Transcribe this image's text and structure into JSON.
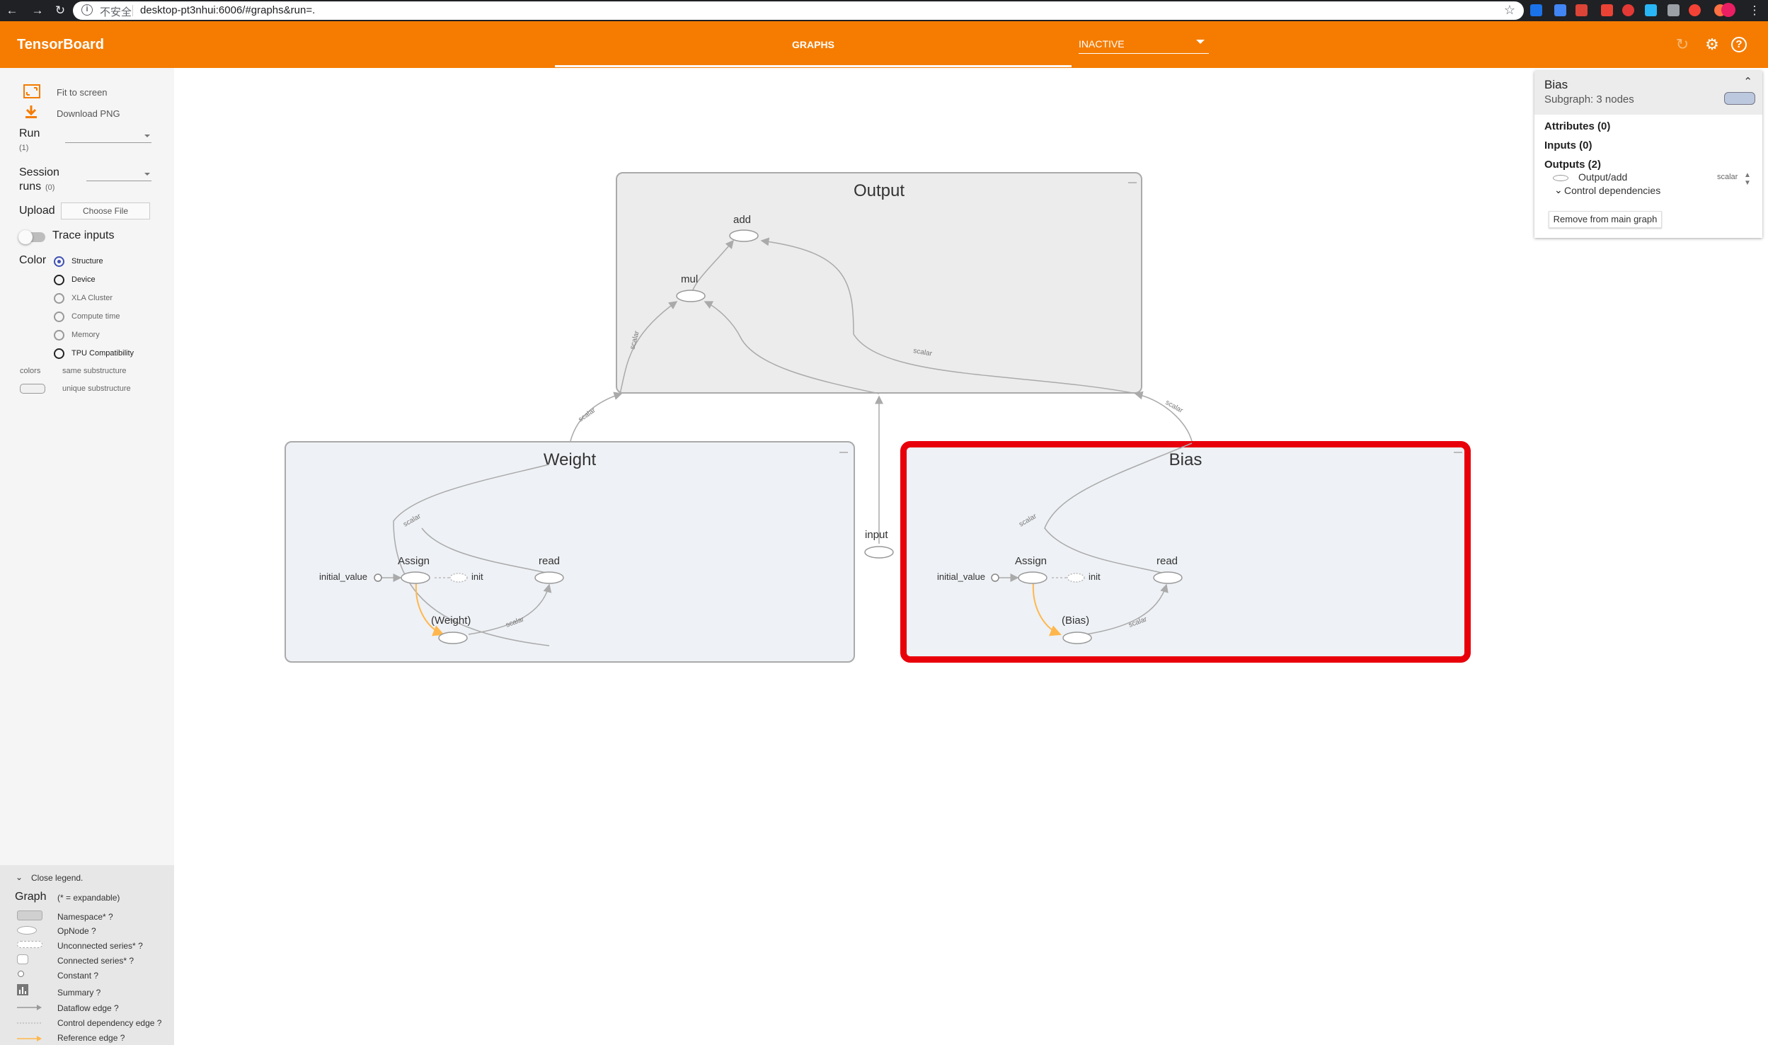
{
  "browser": {
    "insecure_label": "不安全",
    "url": "desktop-pt3nhui:6006/#graphs&run=."
  },
  "toolbar": {
    "title": "TensorBoard",
    "tab_graphs": "GRAPHS",
    "inactive_label": "INACTIVE"
  },
  "sidebar": {
    "fit_to_screen": "Fit to screen",
    "download_png": "Download PNG",
    "run_label": "Run",
    "run_count": "(1)",
    "session_label_1": "Session",
    "session_label_2": "runs",
    "session_count": "(0)",
    "upload_label": "Upload",
    "choose_file": "Choose File",
    "trace_inputs": "Trace inputs",
    "color_label": "Color",
    "color_options": [
      "Structure",
      "Device",
      "XLA Cluster",
      "Compute time",
      "Memory",
      "TPU Compatibility"
    ],
    "colors_label": "colors",
    "same_substructure": "same substructure",
    "unique_substructure": "unique substructure"
  },
  "legend": {
    "close": "Close legend.",
    "graph": "Graph",
    "expandable": "(* = expandable)",
    "items": [
      "Namespace* ?",
      "OpNode ?",
      "Unconnected series* ?",
      "Connected series* ?",
      "Constant ?",
      "Summary ?",
      "Dataflow edge ?",
      "Control dependency edge ?",
      "Reference edge ?"
    ]
  },
  "graph": {
    "output": {
      "title": "Output",
      "add": "add",
      "mul": "mul"
    },
    "weight": {
      "title": "Weight",
      "initial_value": "initial_value",
      "assign": "Assign",
      "init": "init",
      "read": "read",
      "var": "(Weight)"
    },
    "bias": {
      "title": "Bias",
      "initial_value": "initial_value",
      "assign": "Assign",
      "init": "init",
      "read": "read",
      "var": "(Bias)"
    },
    "input": "input",
    "edge_scalar": "scalar"
  },
  "card": {
    "title": "Bias",
    "subtitle": "Subgraph: 3 nodes",
    "attributes": "Attributes (0)",
    "inputs": "Inputs (0)",
    "outputs": "Outputs (2)",
    "output_item": "Output/add",
    "output_item_type": "scalar",
    "control_deps": "Control dependencies",
    "remove_button": "Remove from main graph"
  },
  "colors": {
    "accent": "#f57c00",
    "selection": "#e8000b",
    "reference_edge": "#ffb74d"
  }
}
